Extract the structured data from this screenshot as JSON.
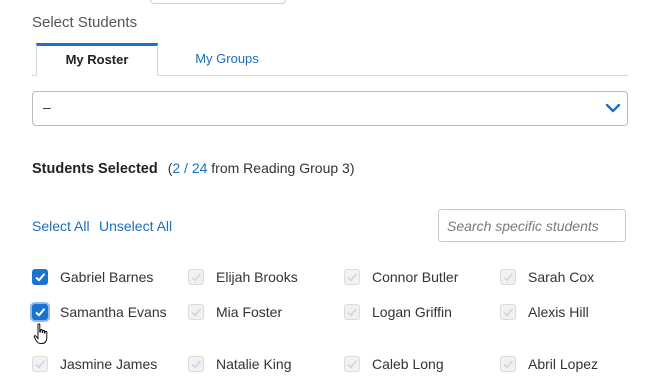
{
  "header": {
    "section_title": "Select Students"
  },
  "tabs": [
    {
      "label": "My Roster",
      "active": true
    },
    {
      "label": "My Groups",
      "active": false
    }
  ],
  "dropdown": {
    "value": "–",
    "icon": "chevron-down-icon"
  },
  "selection": {
    "label": "Students Selected",
    "open_paren": "(",
    "count": "2 / 24",
    "source": " from Reading Group 3)"
  },
  "actions": {
    "select_all": "Select All",
    "unselect_all": "Unselect All"
  },
  "search": {
    "placeholder": "Search specific students",
    "value": ""
  },
  "students": [
    {
      "name": "Gabriel Barnes",
      "checked": true
    },
    {
      "name": "Elijah Brooks",
      "checked": false
    },
    {
      "name": "Connor Butler",
      "checked": false
    },
    {
      "name": "Sarah Cox",
      "checked": false
    },
    {
      "name": "Samantha Evans",
      "checked": true
    },
    {
      "name": "Mia Foster",
      "checked": false
    },
    {
      "name": "Logan Griffin",
      "checked": false
    },
    {
      "name": "Alexis Hill",
      "checked": false
    },
    {
      "name": "Jasmine James",
      "checked": false
    },
    {
      "name": "Natalie King",
      "checked": false
    },
    {
      "name": "Caleb Long",
      "checked": false
    },
    {
      "name": "Abril Lopez",
      "checked": false
    }
  ],
  "colors": {
    "accent": "#1a73d0",
    "link": "#1a6fc0"
  }
}
